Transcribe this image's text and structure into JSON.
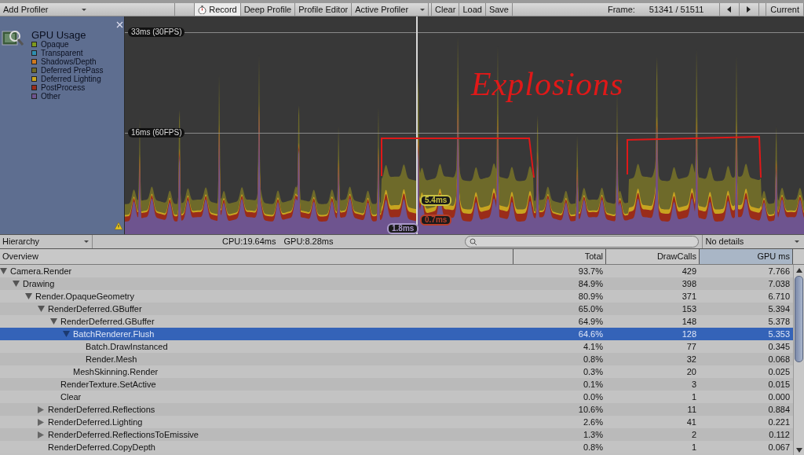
{
  "toolbar": {
    "add_profiler": "Add Profiler",
    "toggles": [
      {
        "label": "Record",
        "on": true,
        "kind": "record"
      },
      {
        "label": "Deep Profile",
        "on": false,
        "kind": "plain"
      },
      {
        "label": "Profile Editor",
        "on": false,
        "kind": "plain"
      }
    ],
    "active_profiler": "Active Profiler",
    "actions": [
      "Clear",
      "Load",
      "Save"
    ],
    "frame_label": "Frame:",
    "frame_value": "51341 / 51511",
    "current": "Current"
  },
  "legend": {
    "title": "GPU Usage",
    "items": [
      {
        "name": "Opaque",
        "color": "#7f9a1e"
      },
      {
        "name": "Transparent",
        "color": "#2f8fb0"
      },
      {
        "name": "Shadows/Depth",
        "color": "#d07a20"
      },
      {
        "name": "Deferred PrePass",
        "color": "#6e6a2a"
      },
      {
        "name": "Deferred Lighting",
        "color": "#c8a420"
      },
      {
        "name": "PostProcess",
        "color": "#9a2c1a"
      },
      {
        "name": "Other",
        "color": "#6e548f"
      }
    ]
  },
  "graph": {
    "thresholds": [
      "33ms (30FPS)",
      "16ms (60FPS)"
    ],
    "readouts": [
      {
        "text": "5.4ms",
        "color": "#c8c040"
      },
      {
        "text": "0.7ms",
        "color": "#b8402a"
      },
      {
        "text": "1.8ms",
        "color": "#a898c8"
      }
    ],
    "annotation": "Explosions"
  },
  "details_bar": {
    "view": "Hierarchy",
    "cpu": "CPU:19.64ms",
    "gpu": "GPU:8.28ms",
    "detail_mode": "No details"
  },
  "table": {
    "columns": [
      {
        "label": "Overview",
        "selected": false
      },
      {
        "label": "Total",
        "selected": false
      },
      {
        "label": "DrawCalls",
        "selected": false
      },
      {
        "label": "GPU ms",
        "selected": true
      }
    ],
    "rows": [
      {
        "name": "Camera.Render",
        "total": "93.7%",
        "draw_calls": "429",
        "gpu_ms": "7.766",
        "expanded": true,
        "selected": false,
        "children": [
          {
            "name": "Drawing",
            "total": "84.9%",
            "draw_calls": "398",
            "gpu_ms": "7.038",
            "expanded": true,
            "selected": false,
            "children": [
              {
                "name": "Render.OpaqueGeometry",
                "total": "80.9%",
                "draw_calls": "371",
                "gpu_ms": "6.710",
                "expanded": true,
                "selected": false,
                "children": [
                  {
                    "name": "RenderDeferred.GBuffer",
                    "total": "65.0%",
                    "draw_calls": "153",
                    "gpu_ms": "5.394",
                    "expanded": true,
                    "selected": false,
                    "children": [
                      {
                        "name": "RenderDeferred.GBuffer",
                        "total": "64.9%",
                        "draw_calls": "148",
                        "gpu_ms": "5.378",
                        "expanded": true,
                        "selected": false,
                        "children": [
                          {
                            "name": "BatchRenderer.Flush",
                            "total": "64.6%",
                            "draw_calls": "128",
                            "gpu_ms": "5.353",
                            "expanded": true,
                            "selected": true,
                            "children": [
                              {
                                "name": "Batch.DrawInstanced",
                                "total": "4.1%",
                                "draw_calls": "77",
                                "gpu_ms": "0.345",
                                "selected": false
                              },
                              {
                                "name": "Render.Mesh",
                                "total": "0.8%",
                                "draw_calls": "32",
                                "gpu_ms": "0.068",
                                "selected": false
                              }
                            ]
                          },
                          {
                            "name": "MeshSkinning.Render",
                            "total": "0.3%",
                            "draw_calls": "20",
                            "gpu_ms": "0.025",
                            "selected": false
                          }
                        ]
                      },
                      {
                        "name": "RenderTexture.SetActive",
                        "total": "0.1%",
                        "draw_calls": "3",
                        "gpu_ms": "0.015",
                        "selected": false
                      },
                      {
                        "name": "Clear",
                        "total": "0.0%",
                        "draw_calls": "1",
                        "gpu_ms": "0.000",
                        "selected": false
                      }
                    ]
                  },
                  {
                    "name": "RenderDeferred.Reflections",
                    "total": "10.6%",
                    "draw_calls": "11",
                    "gpu_ms": "0.884",
                    "expanded": false,
                    "selected": false
                  },
                  {
                    "name": "RenderDeferred.Lighting",
                    "total": "2.6%",
                    "draw_calls": "41",
                    "gpu_ms": "0.221",
                    "expanded": false,
                    "selected": false
                  },
                  {
                    "name": "RenderDeferred.ReflectionsToEmissive",
                    "total": "1.3%",
                    "draw_calls": "2",
                    "gpu_ms": "0.112",
                    "expanded": false,
                    "selected": false
                  },
                  {
                    "name": "RenderDeferred.CopyDepth",
                    "total": "0.8%",
                    "draw_calls": "1",
                    "gpu_ms": "0.067",
                    "selected": false
                  }
                ]
              }
            ]
          }
        ]
      }
    ]
  }
}
